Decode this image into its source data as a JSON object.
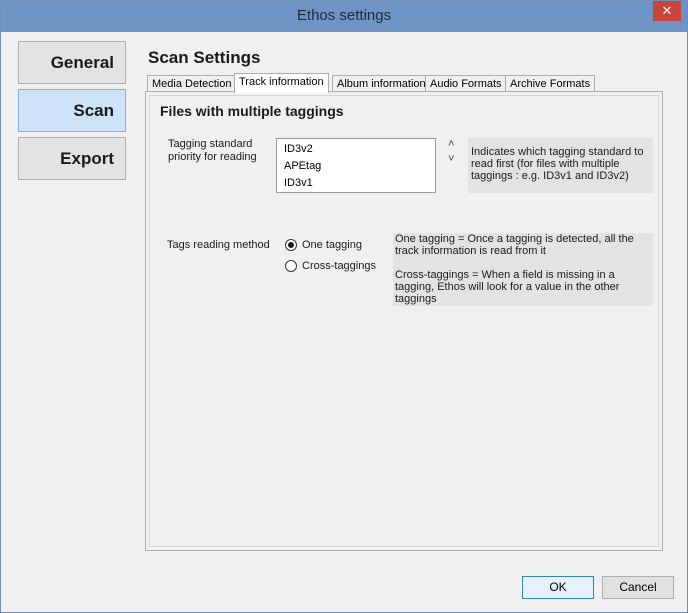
{
  "window": {
    "title": "Ethos settings",
    "close_glyph": "✕"
  },
  "nav": {
    "items": [
      {
        "label": "General",
        "active": false
      },
      {
        "label": "Scan",
        "active": true
      },
      {
        "label": "Export",
        "active": false
      }
    ]
  },
  "section": {
    "title": "Scan Settings"
  },
  "tabs": [
    {
      "label": "Media Detection",
      "active": false
    },
    {
      "label": "Track information",
      "active": true
    },
    {
      "label": "Album information",
      "active": false
    },
    {
      "label": "Audio Formats",
      "active": false
    },
    {
      "label": "Archive Formats",
      "active": false
    }
  ],
  "group": {
    "title": "Files with multiple taggings",
    "priority": {
      "label_line1": "Tagging standard",
      "label_line2": "priority for reading",
      "items": [
        "ID3v2",
        "APEtag",
        "ID3v1"
      ],
      "info_line1": "Indicates which tagging standard to",
      "info_line2": "read first (for files with multiple",
      "info_line3": "taggings : e.g. ID3v1 and ID3v2)"
    },
    "reading_method": {
      "label": "Tags reading method",
      "options": [
        {
          "label": "One tagging",
          "checked": true
        },
        {
          "label": "Cross-taggings",
          "checked": false
        }
      ],
      "info_line1": "One tagging = Once a tagging is detected, all the",
      "info_line2": "track information is read from it",
      "info_line3": "Cross-taggings = When a field is missing in a",
      "info_line4": "tagging, Ethos will look for a value in the other",
      "info_line5": "taggings"
    }
  },
  "buttons": {
    "ok": "OK",
    "cancel": "Cancel"
  },
  "icons": {
    "up": "˄",
    "down": "˅"
  }
}
